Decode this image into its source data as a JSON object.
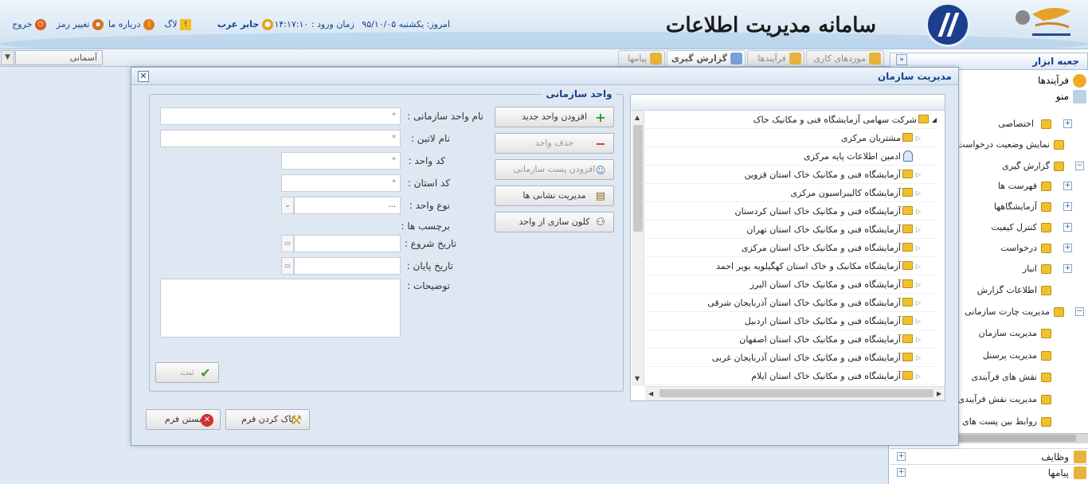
{
  "header": {
    "system_title": "سامانه مدیریت اطلاعات آزمایشگاه",
    "date_text": "امروز: یکشنبه ۹۵/۱۰/۰۵",
    "login_time": "زمان ورود : ۱۴:۱۷:۱۰",
    "user_name": "جابر عرب",
    "log_label": "لاگ",
    "about_label": "درباره ما",
    "change_password_label": "تغییر رمز",
    "logout_label": "خروج"
  },
  "toolbar": {
    "tabs": [
      {
        "label": "موردهای کاری"
      },
      {
        "label": "فرآیندها"
      },
      {
        "label": "گزارش گیری"
      },
      {
        "label": "پیامها"
      }
    ],
    "theme_value": "آسمانی"
  },
  "sidebar": {
    "title": "جعبه ابزار",
    "processes_label": "فرآیندها",
    "menu_label": "منو",
    "items": [
      {
        "label": "اختصاصی"
      },
      {
        "label": "نمایش وضعیت درخواست"
      },
      {
        "label": "گزارش گیری"
      },
      {
        "label": "فهرست ها"
      },
      {
        "label": "آزمایشگاهها"
      },
      {
        "label": "کنترل کیفیت"
      },
      {
        "label": "درخواست"
      },
      {
        "label": "انبار"
      },
      {
        "label": "اطلاعات گزارش"
      },
      {
        "label": "مدیریت چارت سازمانی"
      },
      {
        "label": "مدیریت سازمان"
      },
      {
        "label": "مدیریت پرسنل"
      },
      {
        "label": "نقش های فرآیندی"
      },
      {
        "label": "مدیریت نقش فرآیندی"
      },
      {
        "label": "روابط بین پست های"
      }
    ],
    "tasks_label": "وظایف",
    "messages_label": "پیامها"
  },
  "dialog": {
    "title": "مدیریت سازمان",
    "fieldset_legend": "واحد سازمانی",
    "buttons": {
      "add_unit": "افزودن واحد جدید",
      "delete_unit": "حذف واحد",
      "add_post": "افزودن پست سازمانی",
      "manage_addresses": "مدیریت نشانی ها",
      "clone_unit": "کلون سازی از واحد",
      "submit": "ثبت",
      "clear_form": "پاک کردن فرم",
      "close_form": "بستن فرم"
    },
    "fields": {
      "unit_name_label": "نام واحد سازمانی :",
      "latin_name_label": "نام لاتین :",
      "unit_code_label": "کد واحد :",
      "province_code_label": "کد استان :",
      "unit_type_label": "نوع واحد :",
      "unit_type_value": "...",
      "tags_label": "برچسب ها :",
      "start_date_label": "تاریخ شروع :",
      "end_date_label": "تاریخ پایان :",
      "description_label": "توضیحات :",
      "required_mark": "*"
    },
    "tree": [
      {
        "label": "شرکت سهامی آزمایشگاه فنی و مکانیک خاک"
      },
      {
        "label": "مشتریان مرکزی"
      },
      {
        "label": "ادمین اطلاعات پایه مرکزی"
      },
      {
        "label": "آزمایشگاه فنی و مکانیک خاک استان قزوین"
      },
      {
        "label": "آزمایشگاه کالیبراسیون مرکزی"
      },
      {
        "label": "آزمایشگاه فنی و مکانیک خاک استان کردستان"
      },
      {
        "label": "آزمایشگاه فنی و مکانیک خاک استان تهران"
      },
      {
        "label": "آزمایشگاه فنی و مکانیک خاک استان مرکزی"
      },
      {
        "label": "آزمایشگاه مکانیک و خاک استان کهگیلویه بویر احمد"
      },
      {
        "label": "آزمایشگاه فنی و مکانیک خاک استان البرز"
      },
      {
        "label": "آزمایشگاه فنی و مکانیک خاک استان آذربایجان شرقی"
      },
      {
        "label": "آزمایشگاه فنی و مکانیک خاک استان اردبیل"
      },
      {
        "label": "آزمایشگاه فنی و مکانیک خاک استان اصفهان"
      },
      {
        "label": "آزمایشگاه فنی و مکانیک خاک استان آذربایجان غربی"
      },
      {
        "label": "آزمایشگاه فنی و مکانیک خاک استان ایلام"
      }
    ]
  },
  "colors": {
    "accent": "#15428b",
    "folder": "#f2c029",
    "header_bg": "#dbe9f5"
  }
}
